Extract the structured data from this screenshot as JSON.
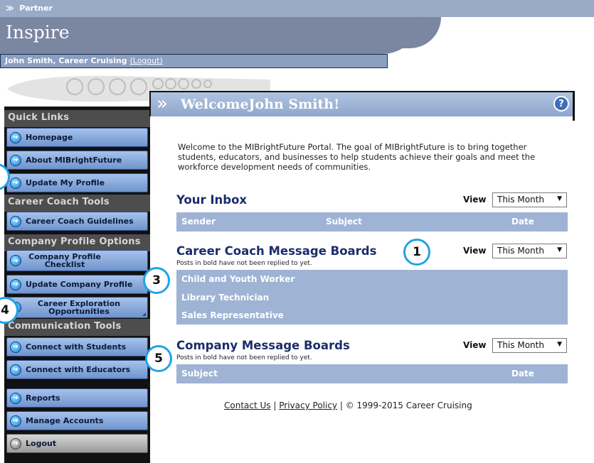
{
  "partner_bar": {
    "label": "Partner"
  },
  "header": {
    "title": "Inspire",
    "user_name": "John Smith, Career Cruising",
    "logout_link": "(Logout)"
  },
  "sidebar": {
    "sections": [
      {
        "header": "Quick Links",
        "items": [
          "Homepage",
          "About MIBrightFuture",
          "Update My Profile"
        ]
      },
      {
        "header": "Career Coach Tools",
        "items": [
          "Career Coach Guidelines"
        ]
      },
      {
        "header": "Company Profile Options",
        "items": [
          "Company Profile Checklist",
          "Update Company Profile",
          "Career Exploration Opportunities"
        ]
      },
      {
        "header": "Communication Tools",
        "items": [
          "Connect with Students",
          "Connect with Educators"
        ]
      }
    ],
    "bottom_items": [
      "Reports",
      "Manage Accounts",
      "Logout"
    ]
  },
  "main": {
    "welcome_title": "WelcomeJohn Smith!",
    "help_icon": "?",
    "intro": "Welcome to the MIBrightFuture Portal. The goal of MIBrightFuture is to bring together students, educators, and businesses to help students achieve their goals and meet the workforce development needs of communities.",
    "inbox": {
      "title": "Your Inbox",
      "view_label": "View",
      "view_value": "This Month",
      "columns": [
        "Sender",
        "Subject",
        "Date"
      ]
    },
    "coach_boards": {
      "title": "Career Coach Message Boards",
      "note": "Posts in bold have not been replied to yet.",
      "view_label": "View",
      "view_value": "This Month",
      "items": [
        "Child and Youth Worker",
        "Library Technician",
        "Sales Representative"
      ]
    },
    "company_boards": {
      "title": "Company Message Boards",
      "note": "Posts in bold have not been replied to yet.",
      "view_label": "View",
      "view_value": "This Month",
      "columns": [
        "Subject",
        "Date"
      ]
    }
  },
  "footer": {
    "contact": "Contact Us",
    "separator": "|",
    "privacy": "Privacy Policy",
    "copyright": "| © 1999-2015 Career Cruising"
  },
  "callouts": [
    "1",
    "3",
    "4",
    "5"
  ],
  "colors": {
    "nav_button": "#7d9fd6",
    "nav_header": "#4d4d4d",
    "table_header": "#9fb3d4",
    "section_title": "#1b2d6b",
    "callout_ring": "#1fa3e8"
  }
}
